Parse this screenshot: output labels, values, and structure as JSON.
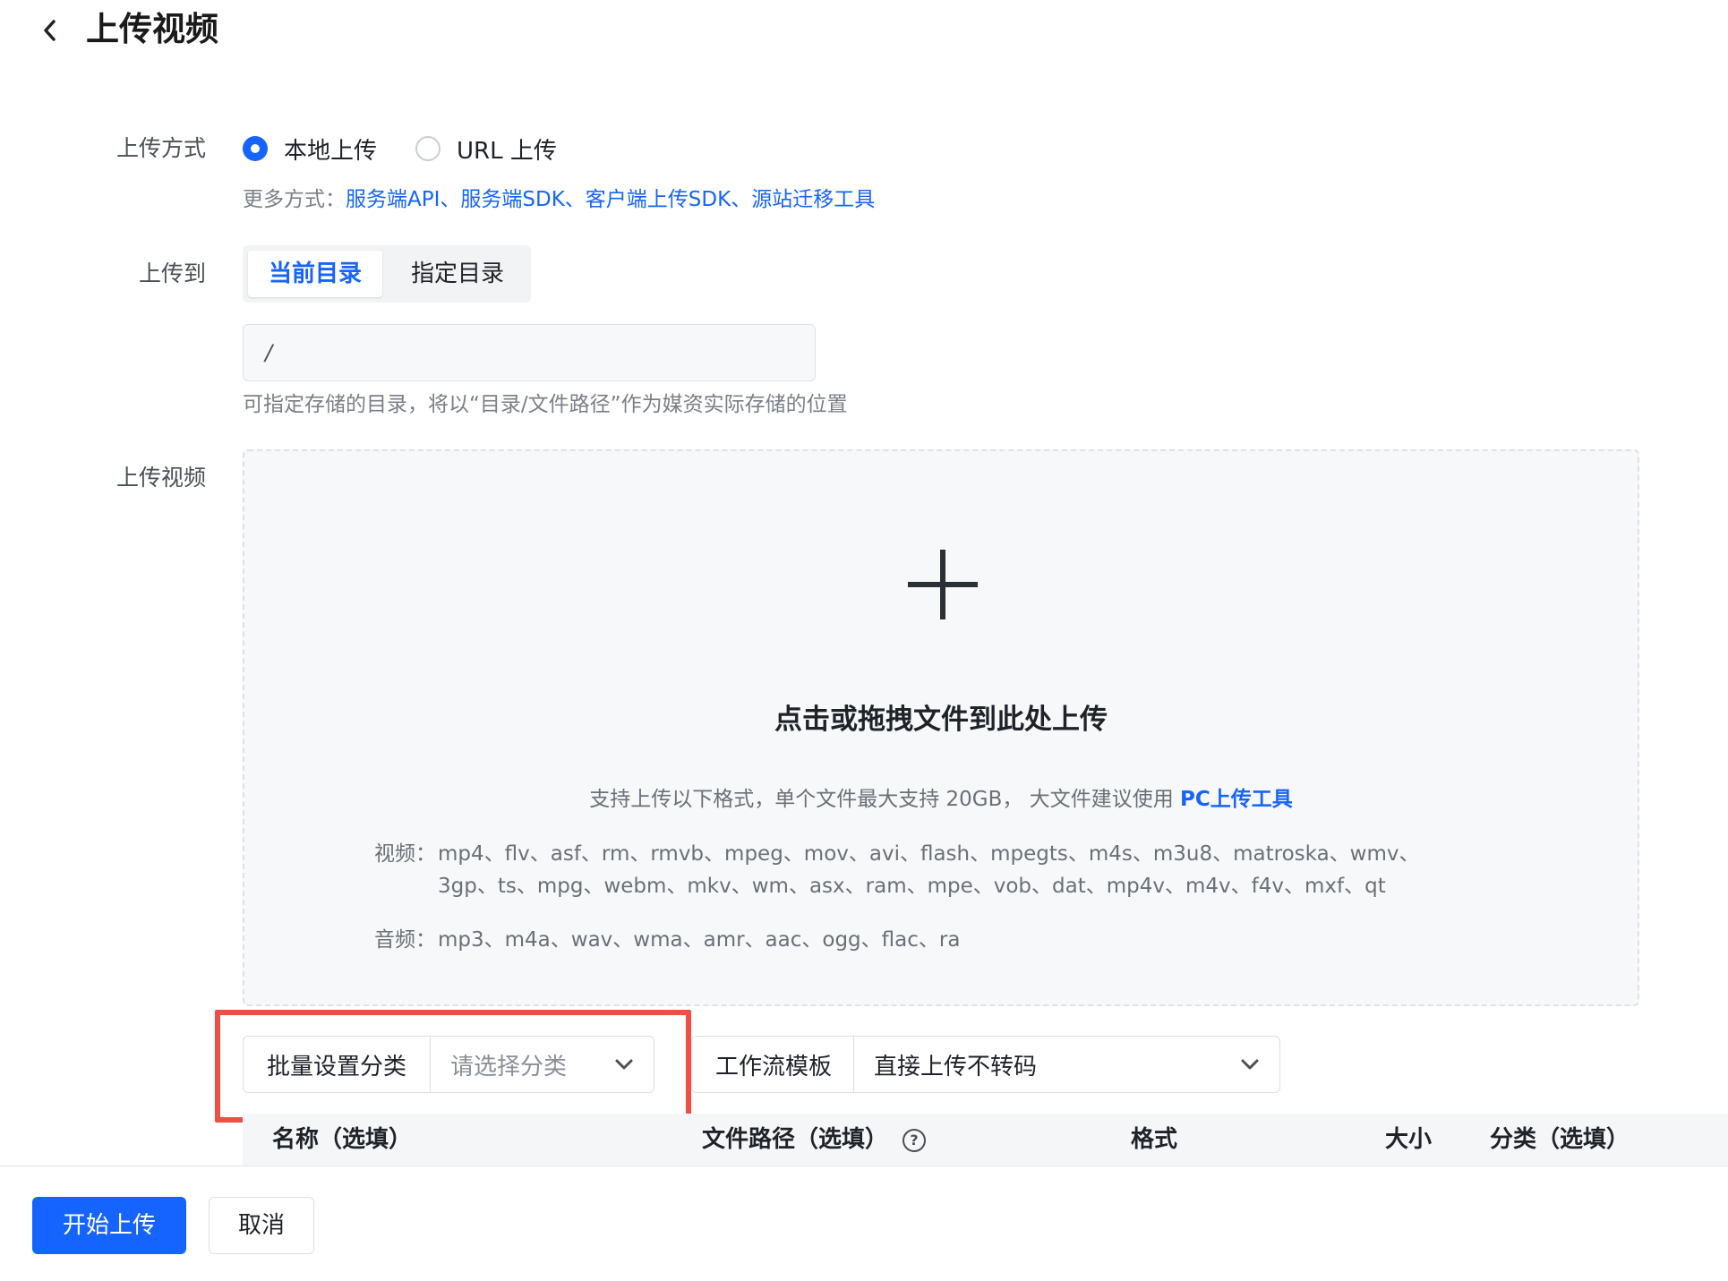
{
  "header": {
    "title": "上传视频"
  },
  "form": {
    "upload_method": {
      "label": "上传方式",
      "options": [
        {
          "label": "本地上传",
          "selected": true
        },
        {
          "label": "URL 上传",
          "selected": false
        }
      ],
      "more_prefix": "更多方式：",
      "more_links": [
        "服务端API",
        "服务端SDK",
        "客户端上传SDK",
        "源站迁移工具"
      ],
      "separator": "、"
    },
    "upload_to": {
      "label": "上传到",
      "tabs": [
        "当前目录",
        "指定目录"
      ],
      "path_value": "/",
      "hint": "可指定存储的目录，将以“目录/文件路径”作为媒资实际存储的位置"
    },
    "upload_video": {
      "label": "上传视频",
      "drop_title": "点击或拖拽文件到此处上传",
      "support_text": "支持上传以下格式，单个文件最大支持 20GB， 大文件建议使用 ",
      "support_link": "PC上传工具",
      "video_label": "视频：",
      "video_formats": "mp4、flv、asf、rm、rmvb、mpeg、mov、avi、flash、mpegts、m4s、m3u8、matroska、wmv、3gp、ts、mpg、webm、mkv、wm、asx、ram、mpe、vob、dat、mp4v、m4v、f4v、mxf、qt",
      "audio_label": "音频：",
      "audio_formats": "mp3、m4a、wav、wma、amr、aac、ogg、flac、ra"
    },
    "batch_category": {
      "prefix": "批量设置分类",
      "placeholder": "请选择分类"
    },
    "workflow": {
      "prefix": "工作流模板",
      "value": "直接上传不转码"
    }
  },
  "table": {
    "columns": [
      "名称（选填）",
      "文件路径（选填）",
      "格式",
      "大小",
      "分类（选填）"
    ]
  },
  "footer": {
    "start_label": "开始上传",
    "cancel_label": "取消"
  },
  "colors": {
    "accent": "#1664ff",
    "highlight_box": "#ee4f46"
  }
}
